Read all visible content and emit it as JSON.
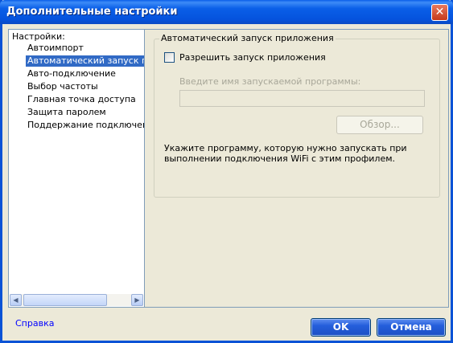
{
  "window": {
    "title": "Дополнительные настройки",
    "close_glyph": "✕"
  },
  "tree": {
    "root_label": "Настройки:",
    "items": [
      {
        "label": "Автоимпорт",
        "selected": false
      },
      {
        "label": "Автоматический запуск приложения",
        "selected": true
      },
      {
        "label": "Авто-подключение",
        "selected": false
      },
      {
        "label": "Выбор частоты",
        "selected": false
      },
      {
        "label": "Главная точка доступа",
        "selected": false
      },
      {
        "label": "Защита паролем",
        "selected": false
      },
      {
        "label": "Поддержание подключения",
        "selected": false
      }
    ],
    "scroll_left_glyph": "◀",
    "scroll_right_glyph": "▶"
  },
  "panel": {
    "group_title": "Автоматический запуск приложения",
    "checkbox_label": "Разрешить запуск приложения",
    "checkbox_checked": false,
    "field_label": "Введите имя запускаемой программы:",
    "field_value": "",
    "browse_label": "Обзор...",
    "hint": "Укажите программу, которую нужно запускать при выполнении подключения WiFi с этим профилем."
  },
  "footer": {
    "help_link": "Справка",
    "ok_label": "OK",
    "cancel_label": "Отмена"
  },
  "colors": {
    "title_bar": "#0a5ee8",
    "selection": "#316ac5",
    "link": "#0000ff"
  }
}
